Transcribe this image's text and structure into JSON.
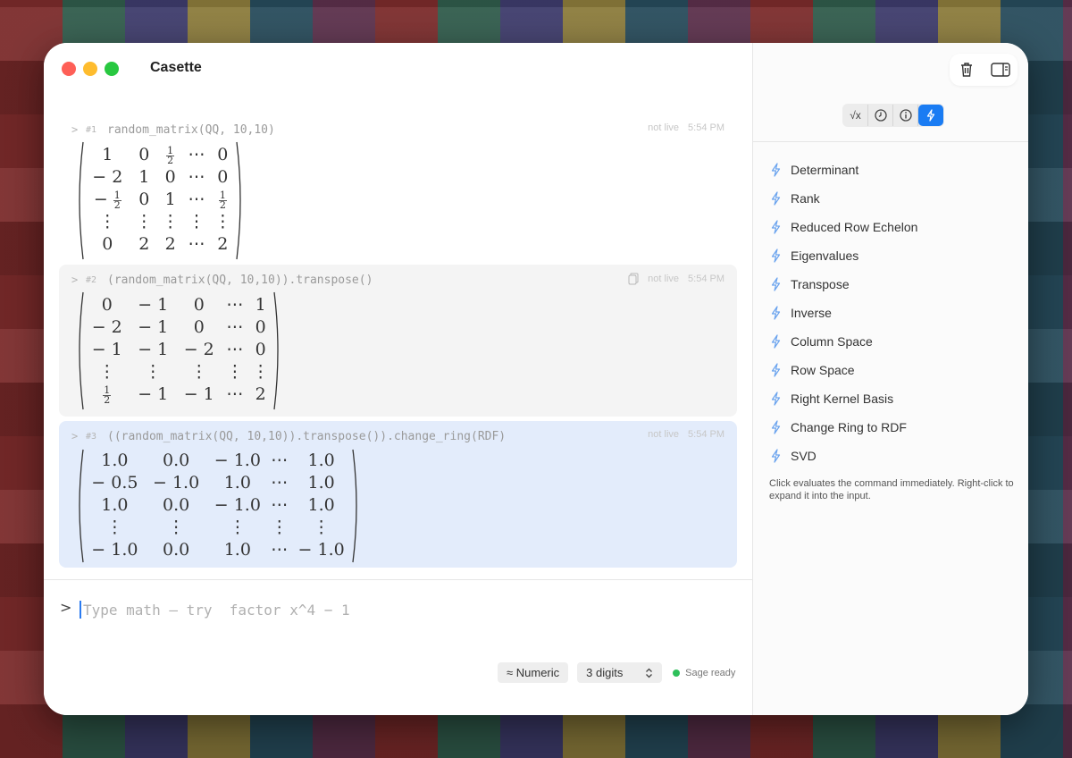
{
  "app": {
    "title": "Casette"
  },
  "cells": [
    {
      "num": "#1",
      "command": "random_matrix(QQ, 10,10)",
      "status": "not live",
      "time": "5:54 PM",
      "rows": [
        [
          "1",
          "0",
          "1/2",
          "⋯",
          "0"
        ],
        [
          "− 2",
          "1",
          "0",
          "⋯",
          "0"
        ],
        [
          "− 1/2",
          "0",
          "1",
          "⋯",
          "1/2"
        ],
        [
          "⋮",
          "⋮",
          "⋮",
          "⋮",
          "⋮"
        ],
        [
          "0",
          "2",
          "2",
          "⋯",
          "2"
        ]
      ]
    },
    {
      "num": "#2",
      "command": "(random_matrix(QQ, 10,10)).transpose()",
      "status": "not live",
      "time": "5:54 PM",
      "rows": [
        [
          "0",
          "− 1",
          "0",
          "⋯",
          "1"
        ],
        [
          "− 2",
          "− 1",
          "0",
          "⋯",
          "0"
        ],
        [
          "− 1",
          "− 1",
          "− 2",
          "⋯",
          "0"
        ],
        [
          "⋮",
          "⋮",
          "⋮",
          "⋮",
          "⋮"
        ],
        [
          "1/2",
          "− 1",
          "− 1",
          "⋯",
          "2"
        ]
      ]
    },
    {
      "num": "#3",
      "command": "((random_matrix(QQ, 10,10)).transpose()).change_ring(RDF)",
      "status": "not live",
      "time": "5:54 PM",
      "rows": [
        [
          "1.0",
          "0.0",
          "− 1.0",
          "⋯",
          "1.0"
        ],
        [
          "− 0.5",
          "− 1.0",
          "1.0",
          "⋯",
          "1.0"
        ],
        [
          "1.0",
          "0.0",
          "− 1.0",
          "⋯",
          "1.0"
        ],
        [
          "⋮",
          "⋮",
          "⋮",
          "⋮",
          "⋮"
        ],
        [
          "− 1.0",
          "0.0",
          "1.0",
          "⋯",
          "− 1.0"
        ]
      ]
    }
  ],
  "input": {
    "prompt": ">",
    "placeholder": "Type math — try  factor x^4 − 1"
  },
  "status_bar": {
    "mode": "≈ Numeric",
    "digits": "3 digits",
    "digits_arrow": "⌃⌄",
    "engine_status": "Sage ready"
  },
  "sidebar": {
    "segments": [
      {
        "name": "sqrt-icon",
        "label": "√x"
      },
      {
        "name": "clock-icon",
        "label": ""
      },
      {
        "name": "info-icon",
        "label": ""
      },
      {
        "name": "bolt-icon",
        "label": ""
      }
    ],
    "actions": [
      "Determinant",
      "Rank",
      "Reduced Row Echelon",
      "Eigenvalues",
      "Transpose",
      "Inverse",
      "Column Space",
      "Row Space",
      "Right Kernel Basis",
      "Change Ring to RDF",
      "SVD"
    ],
    "hint": "Click evaluates the command immediately. Right-click to expand it into the input."
  },
  "colors": {
    "accent": "#1a7cf3",
    "bolt": "#6aa3ee",
    "selected_cell": "#e3ecfb",
    "ready": "#2ec05a"
  }
}
